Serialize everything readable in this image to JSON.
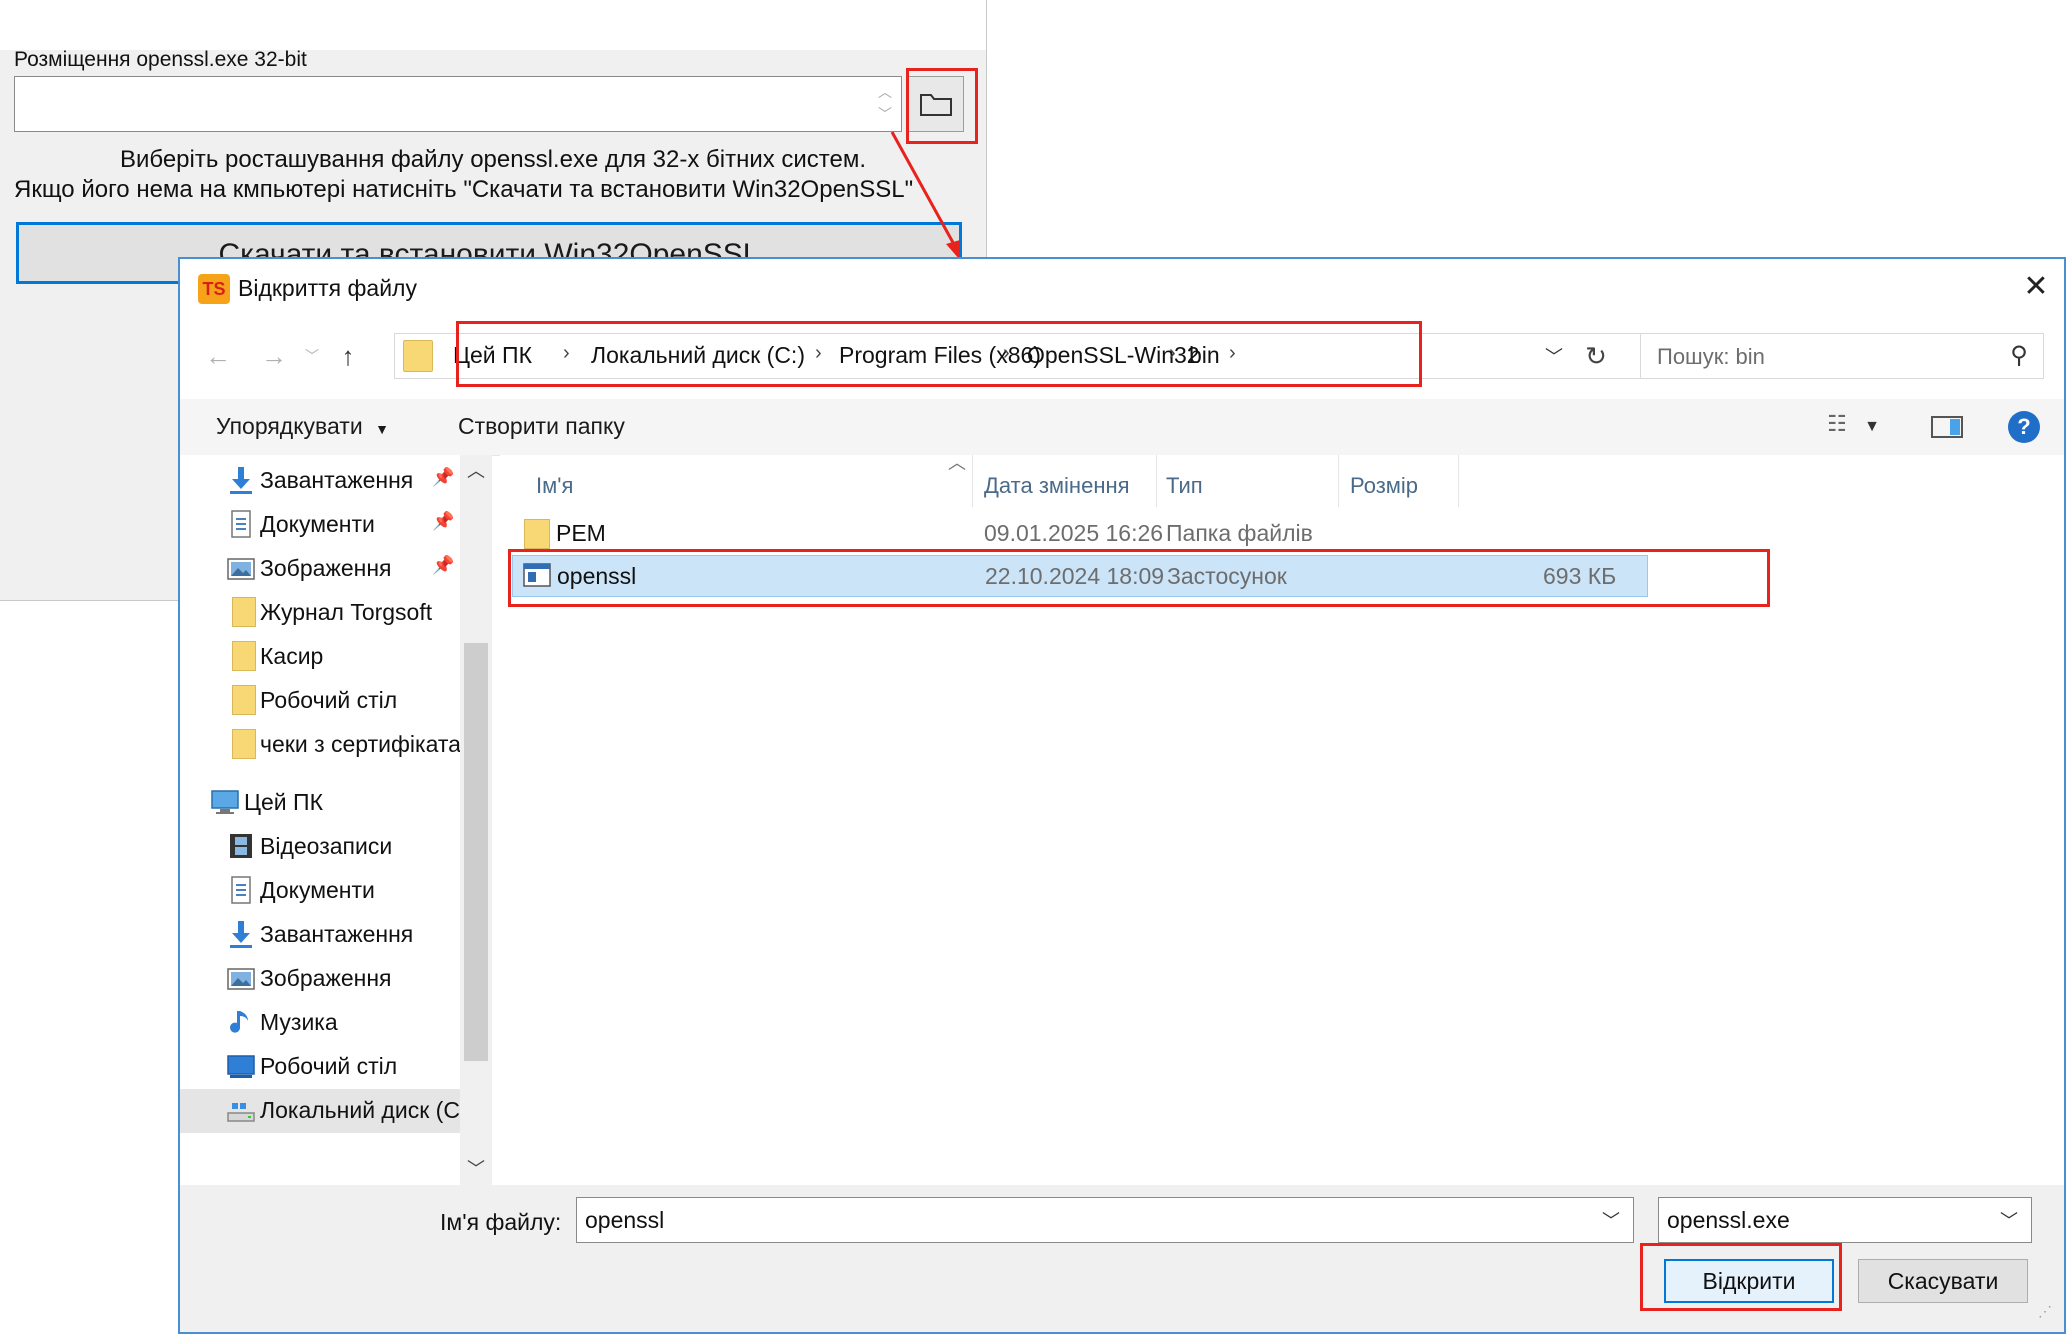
{
  "background_window": {
    "path_label": "Розміщення openssl.exe 32-bit",
    "path_value": "",
    "description_line1": "Виберіть росташування файлу openssl.exe для 32-х бітних систем.",
    "description_line2": "Якщо його нема на кмпьютері натисніть \"Скачати та встановити Win32OpenSSL\"",
    "download_button": "Скачати та встановити Win32OpenSSL"
  },
  "dialog": {
    "title": "Відкриття файлу",
    "app_badge": "TS",
    "close_glyph": "✕",
    "breadcrumbs": [
      "Цей ПК",
      "Локальний диск (C:)",
      "Program Files (x86)",
      "OpenSSL-Win32",
      "bin"
    ],
    "search_placeholder": "Пошук: bin",
    "toolbar": {
      "organize": "Упорядкувати",
      "new_folder": "Створити папку"
    },
    "nav_items": [
      {
        "label": "Завантаження",
        "icon": "download-arrow-icon",
        "pinned": true
      },
      {
        "label": "Документи",
        "icon": "document-icon",
        "pinned": true
      },
      {
        "label": "Зображення",
        "icon": "pictures-icon",
        "pinned": true
      },
      {
        "label": "Журнал Torgsoft",
        "icon": "folder-icon",
        "pinned": false
      },
      {
        "label": "Касир",
        "icon": "folder-icon",
        "pinned": false
      },
      {
        "label": "Робочий стіл",
        "icon": "folder-icon",
        "pinned": false
      },
      {
        "label": "чеки з сертифікатами",
        "icon": "folder-icon",
        "pinned": false
      },
      {
        "label": "Цей ПК",
        "icon": "computer-icon",
        "pinned": false
      },
      {
        "label": "Відеозаписи",
        "icon": "video-icon",
        "pinned": false
      },
      {
        "label": "Документи",
        "icon": "document-icon",
        "pinned": false
      },
      {
        "label": "Завантаження",
        "icon": "download-arrow-icon",
        "pinned": false
      },
      {
        "label": "Зображення",
        "icon": "pictures-icon",
        "pinned": false
      },
      {
        "label": "Музика",
        "icon": "music-icon",
        "pinned": false
      },
      {
        "label": "Робочий стіл",
        "icon": "desktop-icon",
        "pinned": false
      },
      {
        "label": "Локальний диск (C:)",
        "icon": "drive-icon",
        "pinned": false
      }
    ],
    "columns": {
      "name": "Ім'я",
      "date": "Дата змінення",
      "type": "Тип",
      "size": "Розмір"
    },
    "files": [
      {
        "name": "PEM",
        "date": "09.01.2025 16:26",
        "type": "Папка файлів",
        "size": "",
        "icon": "folder-icon",
        "selected": false
      },
      {
        "name": "openssl",
        "date": "22.10.2024 18:09",
        "type": "Застосунок",
        "size": "693 КБ",
        "icon": "application-icon",
        "selected": true
      }
    ],
    "filename_label": "Ім'я файлу:",
    "filename_value": "openssl",
    "filetype_value": "openssl.exe",
    "open_button": "Відкрити",
    "cancel_button": "Скасувати"
  },
  "colors": {
    "highlight_red": "#e8221c",
    "selection_blue": "#cce4f7",
    "accent_blue": "#0078d7"
  }
}
